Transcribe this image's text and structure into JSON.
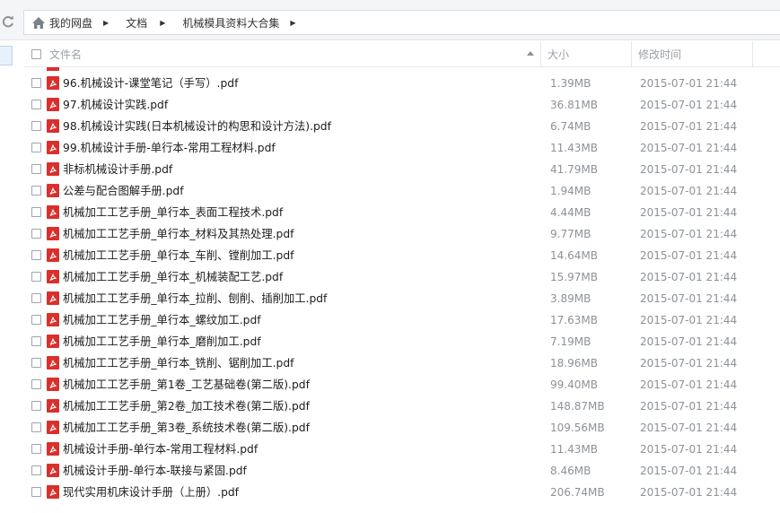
{
  "breadcrumb": [
    "我的网盘",
    "文档",
    "机械模具资料大合集"
  ],
  "columns": {
    "name": "文件名",
    "size": "大小",
    "modified": "修改时间"
  },
  "files": [
    {
      "name": "96.机械设计-课堂笔记（手写）.pdf",
      "size": "1.39MB",
      "modified": "2015-07-01 21:44"
    },
    {
      "name": "97.机械设计实践.pdf",
      "size": "36.81MB",
      "modified": "2015-07-01 21:44"
    },
    {
      "name": "98.机械设计实践(日本机械设计的构思和设计方法).pdf",
      "size": "6.74MB",
      "modified": "2015-07-01 21:44"
    },
    {
      "name": "99.机械设计手册-单行本-常用工程材料.pdf",
      "size": "11.43MB",
      "modified": "2015-07-01 21:44"
    },
    {
      "name": "非标机械设计手册.pdf",
      "size": "41.79MB",
      "modified": "2015-07-01 21:44"
    },
    {
      "name": "公差与配合图解手册.pdf",
      "size": "1.94MB",
      "modified": "2015-07-01 21:44"
    },
    {
      "name": "机械加工工艺手册_单行本_表面工程技术.pdf",
      "size": "4.44MB",
      "modified": "2015-07-01 21:44"
    },
    {
      "name": "机械加工工艺手册_单行本_材料及其热处理.pdf",
      "size": "9.77MB",
      "modified": "2015-07-01 21:44"
    },
    {
      "name": "机械加工工艺手册_单行本_车削、镗削加工.pdf",
      "size": "14.64MB",
      "modified": "2015-07-01 21:44"
    },
    {
      "name": "机械加工工艺手册_单行本_机械装配工艺.pdf",
      "size": "15.97MB",
      "modified": "2015-07-01 21:44"
    },
    {
      "name": "机械加工工艺手册_单行本_拉削、刨削、插削加工.pdf",
      "size": "3.89MB",
      "modified": "2015-07-01 21:44"
    },
    {
      "name": "机械加工工艺手册_单行本_螺纹加工.pdf",
      "size": "17.63MB",
      "modified": "2015-07-01 21:44"
    },
    {
      "name": "机械加工工艺手册_单行本_磨削加工.pdf",
      "size": "7.19MB",
      "modified": "2015-07-01 21:44"
    },
    {
      "name": "机械加工工艺手册_单行本_铣削、锯削加工.pdf",
      "size": "18.96MB",
      "modified": "2015-07-01 21:44"
    },
    {
      "name": "机械加工工艺手册_第1卷_工艺基础卷(第二版).pdf",
      "size": "99.40MB",
      "modified": "2015-07-01 21:44"
    },
    {
      "name": "机械加工工艺手册_第2卷_加工技术卷(第二版).pdf",
      "size": "148.87MB",
      "modified": "2015-07-01 21:44"
    },
    {
      "name": "机械加工工艺手册_第3卷_系统技术卷(第二版).pdf",
      "size": "109.56MB",
      "modified": "2015-07-01 21:44"
    },
    {
      "name": "机械设计手册-单行本-常用工程材料.pdf",
      "size": "11.43MB",
      "modified": "2015-07-01 21:44"
    },
    {
      "name": "机械设计手册-单行本-联接与紧固.pdf",
      "size": "8.46MB",
      "modified": "2015-07-01 21:44"
    },
    {
      "name": "现代实用机床设计手册（上册）.pdf",
      "size": "206.74MB",
      "modified": "2015-07-01 21:44"
    }
  ],
  "colors": {
    "pdf_icon": "#d9302c",
    "meta_text": "#8c9299",
    "header_text": "#9aa0a8",
    "toolbar_bg": "#f4f5f7"
  },
  "icons": {
    "refresh": "refresh-icon",
    "home": "home-icon",
    "file": "pdf-file-icon"
  }
}
